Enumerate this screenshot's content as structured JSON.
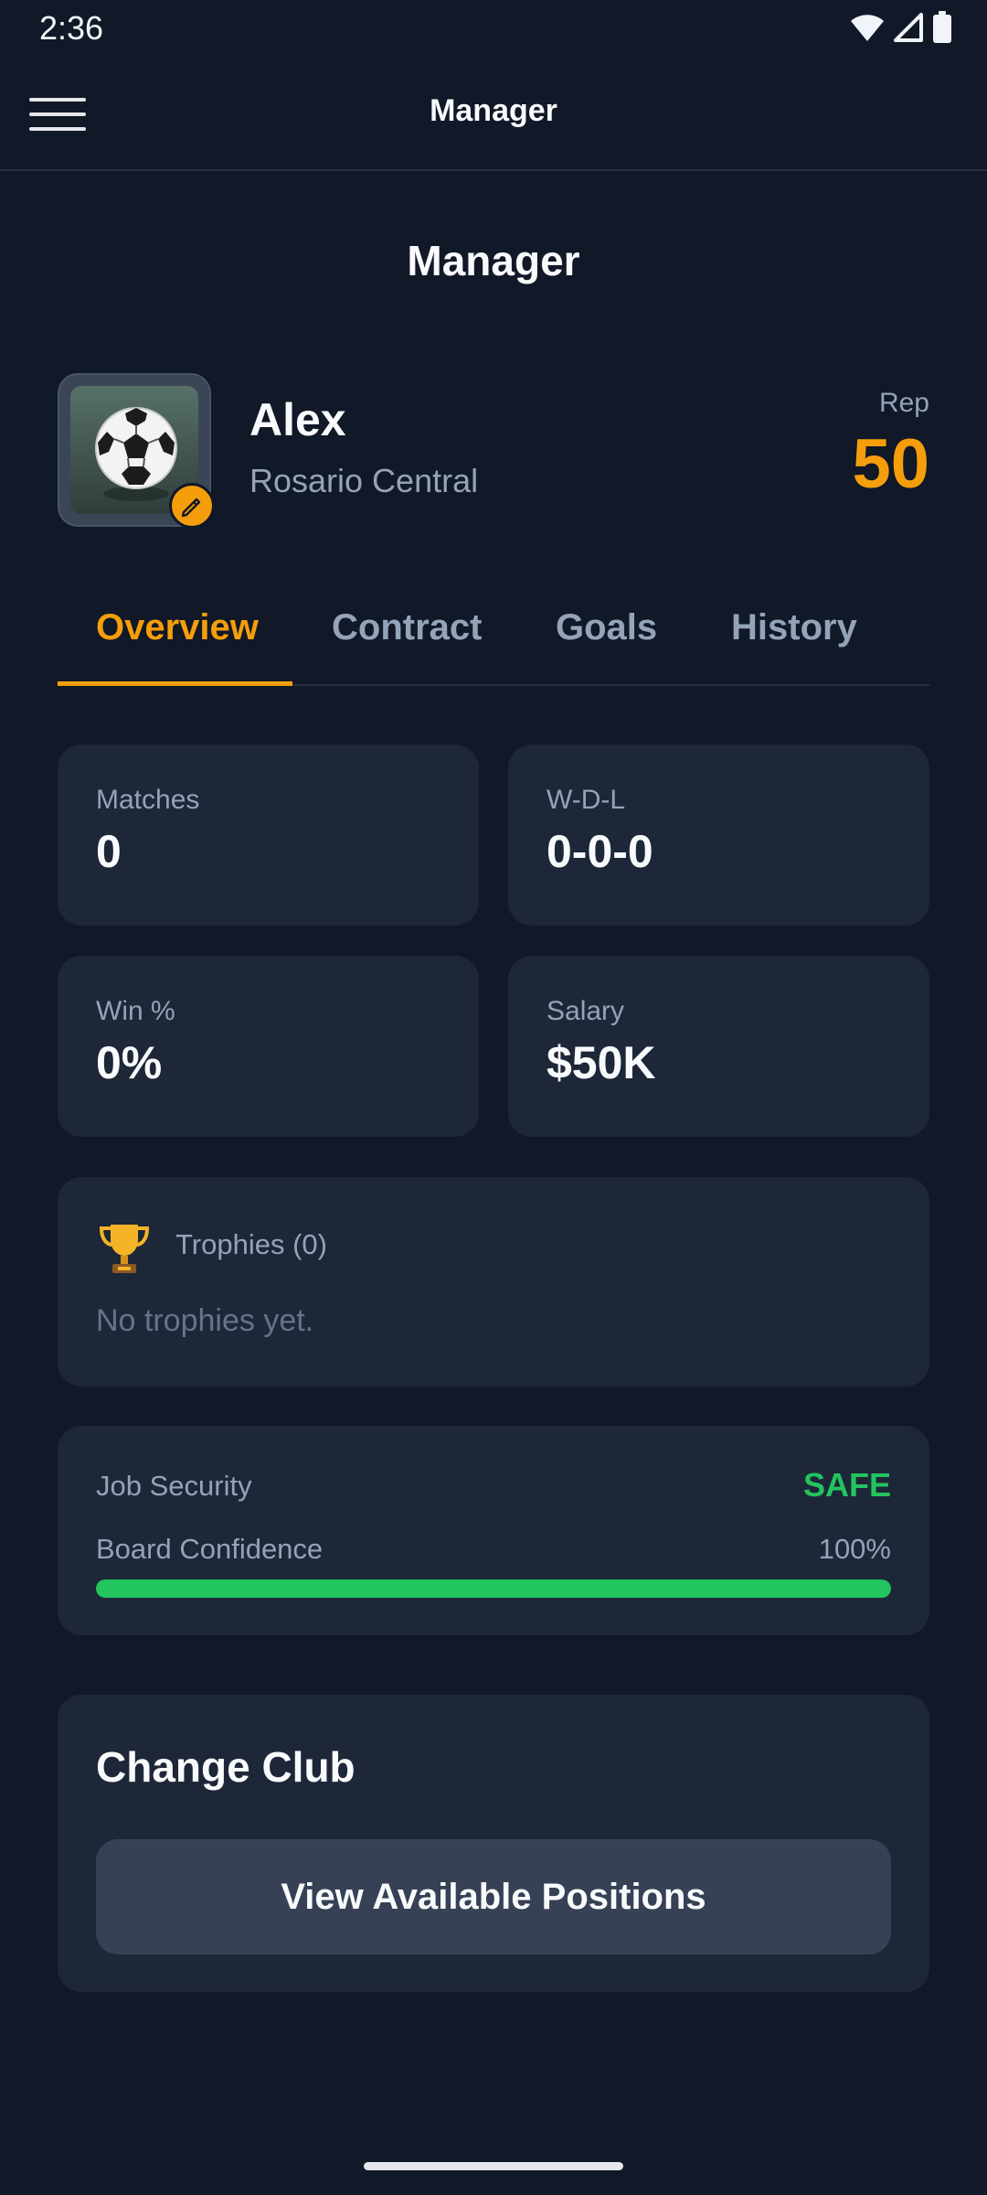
{
  "status_bar": {
    "time": "2:36"
  },
  "app_bar": {
    "title": "Manager"
  },
  "page": {
    "title": "Manager"
  },
  "profile": {
    "name": "Alex",
    "club": "Rosario Central",
    "rep_label": "Rep",
    "rep_value": "50"
  },
  "tabs": [
    {
      "label": "Overview",
      "active": true
    },
    {
      "label": "Contract",
      "active": false
    },
    {
      "label": "Goals",
      "active": false
    },
    {
      "label": "History",
      "active": false
    }
  ],
  "stats": [
    {
      "label": "Matches",
      "value": "0"
    },
    {
      "label": "W-D-L",
      "value": "0-0-0"
    },
    {
      "label": "Win %",
      "value": "0%"
    },
    {
      "label": "Salary",
      "value": "$50K"
    }
  ],
  "trophies": {
    "title": "Trophies (0)",
    "empty_text": "No trophies yet."
  },
  "job_security": {
    "label": "Job Security",
    "status": "SAFE",
    "board_confidence_label": "Board Confidence",
    "board_confidence_value": "100%",
    "board_confidence_fraction": 1.0
  },
  "change_club": {
    "title": "Change Club",
    "button_label": "View Available Positions"
  },
  "colors": {
    "background": "#111827",
    "card": "#1e2738",
    "accent": "#f59e0b",
    "success": "#22c55e"
  }
}
